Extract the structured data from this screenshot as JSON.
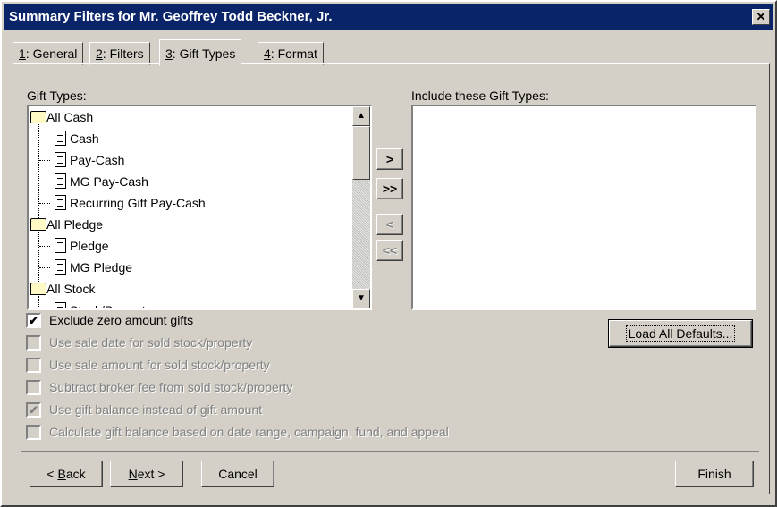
{
  "window": {
    "title": "Summary Filters for Mr. Geoffrey Todd Beckner, Jr.",
    "close_glyph": "✕"
  },
  "tabs": [
    {
      "key": "1",
      "rest": ": General"
    },
    {
      "key": "2",
      "rest": ": Filters"
    },
    {
      "key": "3",
      "rest": ": Gift Types"
    },
    {
      "key": "4",
      "rest": ": Format"
    }
  ],
  "gift_types": {
    "label": "Gift Types:",
    "items": [
      "All Cash",
      "Cash",
      "Pay-Cash",
      "MG Pay-Cash",
      "Recurring Gift Pay-Cash",
      "All Pledge",
      "Pledge",
      "MG Pledge",
      "All Stock",
      "Stock/Property"
    ]
  },
  "include": {
    "label": "Include these Gift Types:"
  },
  "move_buttons": {
    "add": ">",
    "add_all": ">>",
    "remove": "<",
    "remove_all": "<<"
  },
  "load_defaults": "Load All Defaults...",
  "options": [
    {
      "label": "Exclude zero amount gifts",
      "checked": "✔",
      "enabled": true
    },
    {
      "label": "Use sale date for sold stock/property",
      "checked": "",
      "enabled": false
    },
    {
      "label": "Use sale amount for sold stock/property",
      "checked": "",
      "enabled": false
    },
    {
      "label": "Subtract broker fee from sold stock/property",
      "checked": "",
      "enabled": false
    },
    {
      "label": "Use gift balance instead of gift amount",
      "checked": "✔",
      "enabled": false
    },
    {
      "label": "Calculate gift balance based on date range, campaign, fund, and appeal",
      "checked": "",
      "enabled": false
    }
  ],
  "footer": {
    "back_pre": "< ",
    "back_key": "B",
    "back_rest": "ack",
    "next_key": "N",
    "next_rest": "ext >",
    "cancel": "Cancel",
    "finish": "Finish"
  },
  "scroll": {
    "up": "▲",
    "down": "▼"
  }
}
